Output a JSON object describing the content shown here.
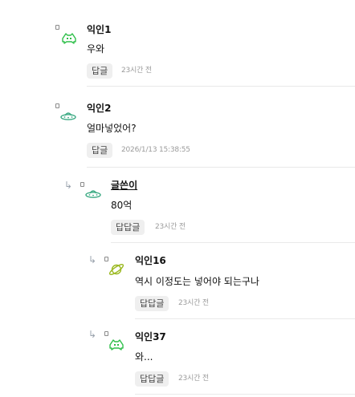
{
  "comments": [
    {
      "author": "익인1",
      "text": "우와",
      "reply_label": "답글",
      "time": "23시간 전",
      "avatar_icon": "space-invader-icon"
    },
    {
      "author": "익인2",
      "text": "얼마넣었어?",
      "reply_label": "답글",
      "time": "2026/1/13 15:38:55",
      "avatar_icon": "ufo-icon"
    },
    {
      "author": "글쓴이",
      "text": "80억",
      "reply_label": "답답글",
      "time": "23시간 전",
      "avatar_icon": "ufo-icon"
    },
    {
      "author": "익인16",
      "text": "역시 이정도는 넣어야 되는구나",
      "reply_label": "답답글",
      "time": "23시간 전",
      "avatar_icon": "planet-icon"
    },
    {
      "author": "익인37",
      "text": "와...",
      "reply_label": "답답글",
      "time": "23시간 전",
      "avatar_icon": "space-invader-icon"
    }
  ],
  "colors": {
    "invader": "#2fbf4a",
    "ufo": "#3aa982",
    "planet": "#9ab81f",
    "arrow": "#9aa3ad"
  }
}
